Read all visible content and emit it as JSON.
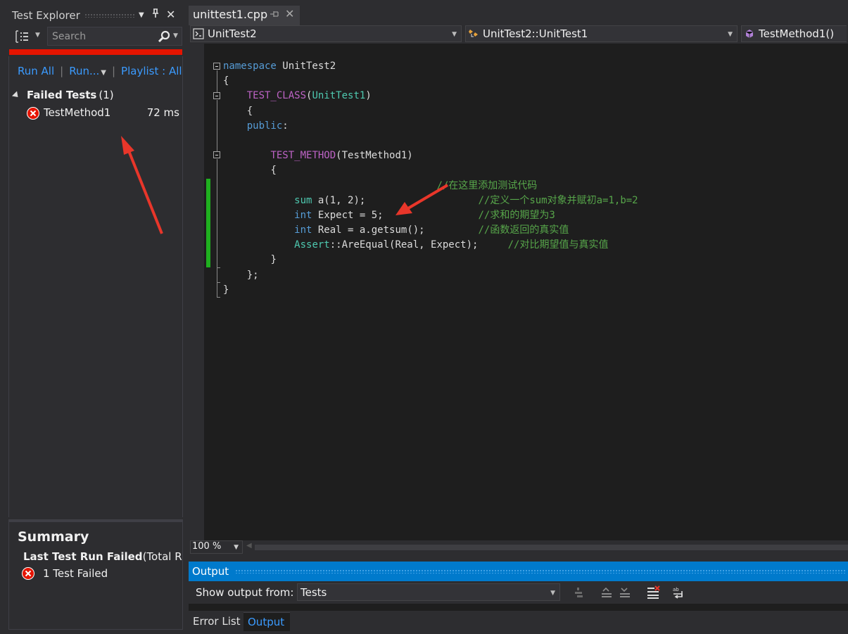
{
  "test_explorer": {
    "title": "Test Explorer",
    "search_placeholder": "Search",
    "run_all": "Run All",
    "run": "Run...",
    "playlist": "Playlist : All",
    "group": {
      "name": "Failed Tests",
      "count": "(1)"
    },
    "tests": [
      {
        "name": "TestMethod1",
        "duration": "72 ms",
        "status": "failed"
      }
    ],
    "summary": {
      "title": "Summary",
      "status": "Last Test Run Failed",
      "status_suffix": "(Total Run",
      "failed": "1 Test Failed"
    }
  },
  "editor": {
    "tab": "unittest1.cpp",
    "nav": {
      "project": "UnitTest2",
      "scope": "UnitTest2::UnitTest1",
      "member": "TestMethod1()"
    },
    "code": {
      "l1_kw": "namespace",
      "l1_name": " UnitTest2",
      "l2": "{",
      "l3_macro": "TEST_CLASS",
      "l3_open": "(",
      "l3_type": "UnitTest1",
      "l3_close": ")",
      "l4": "{",
      "l5_kw": "public",
      "l5_colon": ":",
      "l6": "",
      "l7_macro": "TEST_METHOD",
      "l7_rest": "(TestMethod1)",
      "l8": "{",
      "l9_comment": "//在这里添加测试代码",
      "l10_type": "sum",
      "l10_rest": " a(1, 2);",
      "l10_comment": "//定义一个sum对象并赋初a=1,b=2",
      "l11_kw": "int",
      "l11_rest": " Expect = 5;",
      "l11_comment": "//求和的期望为3",
      "l12_kw": "int",
      "l12_rest": " Real = a.getsum();",
      "l12_comment": "//函数返回的真实值",
      "l13_type": "Assert",
      "l13_rest": "::AreEqual(Real, Expect);",
      "l13_comment": "//对比期望值与真实值",
      "l14": "}",
      "l15": "};",
      "l16": "}"
    },
    "zoom": "100 %"
  },
  "output": {
    "title": "Output",
    "show_from_label": "Show output from:",
    "show_from_value": "Tests",
    "tabs": {
      "errors": "Error List",
      "output": "Output"
    }
  },
  "colors": {
    "fail_red": "#e51400",
    "accent_blue": "#007acc",
    "link_blue": "#3b9bff",
    "change_green": "#1fb01f"
  }
}
